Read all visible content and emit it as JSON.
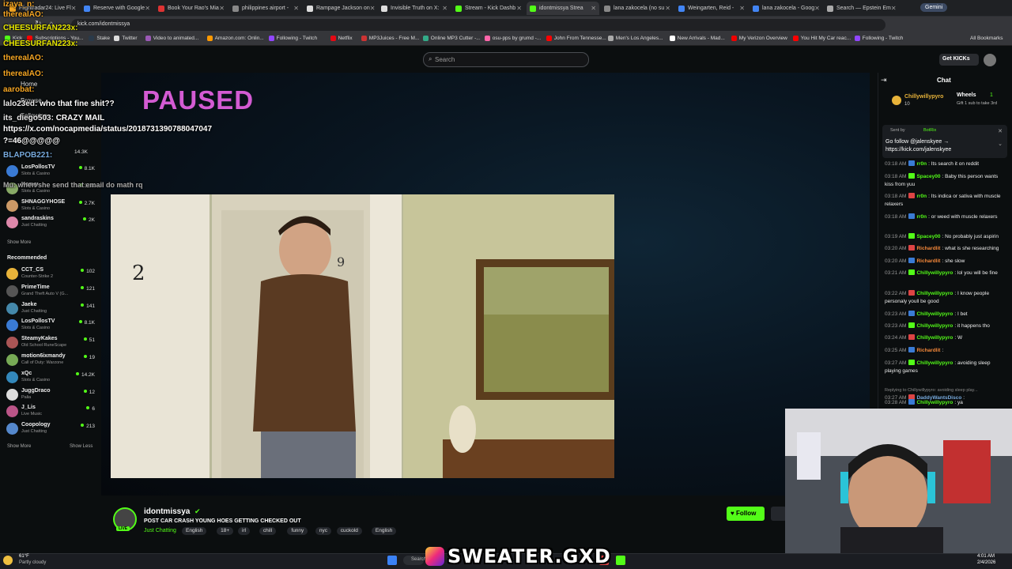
{
  "browser": {
    "tabs": [
      {
        "label": "Flightradar24: Live Fl",
        "color": "#f5a623"
      },
      {
        "label": "Reserve with Google",
        "color": "#4285f4"
      },
      {
        "label": "Book Your Rao's Mia",
        "color": "#d33"
      },
      {
        "label": "philippines airport -",
        "color": "#888"
      },
      {
        "label": "Rampage Jackson on",
        "color": "#ddd"
      },
      {
        "label": "Invisible Truth on X:",
        "color": "#ddd"
      },
      {
        "label": "Stream - Kick Dashb",
        "color": "#53fc18"
      },
      {
        "label": "idontmissya Strea",
        "color": "#53fc18",
        "active": true
      },
      {
        "label": "lana zakocela (no su",
        "color": "#888"
      },
      {
        "label": "Weingarten, Reid -",
        "color": "#4285f4"
      },
      {
        "label": "lana zakocela - Goog",
        "color": "#4285f4"
      },
      {
        "label": "Search — Epstein Em",
        "color": "#aaa"
      }
    ],
    "url": "kick.com/idontmissya",
    "gemini": "Gemini",
    "bookmarks": [
      {
        "label": "Kick",
        "color": "#53fc18"
      },
      {
        "label": "Subscriptions - You...",
        "color": "#f00"
      },
      {
        "label": "Stake",
        "color": "#2a3a4a"
      },
      {
        "label": "Twitter",
        "color": "#ddd"
      },
      {
        "label": "Video to animated...",
        "color": "#9b59b6"
      },
      {
        "label": "Amazon.com: Onlin...",
        "color": "#f90"
      },
      {
        "label": "Following - Twitch",
        "color": "#9146ff"
      },
      {
        "label": "Netflix",
        "color": "#e50914"
      },
      {
        "label": "MP3Juices - Free M...",
        "color": "#c33"
      },
      {
        "label": "Online MP3 Cutter -...",
        "color": "#3a8"
      },
      {
        "label": "osu-pps by grumd -...",
        "color": "#f6a"
      },
      {
        "label": "John From Tennesse...",
        "color": "#f00"
      },
      {
        "label": "Men's Los Angeles...",
        "color": "#aaa"
      },
      {
        "label": "New Arrivals - Mad...",
        "color": "#fff"
      },
      {
        "label": "My Verizon Overview",
        "color": "#e00"
      },
      {
        "label": "You Hit My Car reac...",
        "color": "#f00"
      },
      {
        "label": "Following - Twitch",
        "color": "#9146ff"
      }
    ],
    "all_bookmarks": "All Bookmarks"
  },
  "kick": {
    "search_placeholder": "Search",
    "get_kicks": "Get KICKs",
    "nav": {
      "home": "Home",
      "browse": "Browse",
      "following": "Following"
    },
    "following_channels": [
      {
        "name": "LosPollosTV",
        "game": "Slots & Casino",
        "viewers": "8.1K",
        "color": "#3a7bd5"
      },
      {
        "name": "Konvy",
        "game": "Slots & Casino",
        "viewers": "3.3K",
        "color": "#8a6"
      },
      {
        "name": "SHNAGGYHOSE",
        "game": "Slots & Casino",
        "viewers": "2.7K",
        "color": "#c96"
      },
      {
        "name": "sandraskins",
        "game": "Just Chatting",
        "viewers": "2K",
        "color": "#d8a"
      }
    ],
    "hidden_top_viewers": "14.3K",
    "show_more": "Show More",
    "recommended_title": "Recommended",
    "recommended_channels": [
      {
        "name": "CCT_CS",
        "game": "Counter-Strike 2",
        "viewers": "102",
        "color": "#e8b33a"
      },
      {
        "name": "PrimeTime",
        "game": "Grand Theft Auto V (G...",
        "viewers": "121",
        "color": "#555"
      },
      {
        "name": "Jaeke",
        "game": "Just Chatting",
        "viewers": "141",
        "color": "#48a"
      },
      {
        "name": "LosPollosTV",
        "game": "Slots & Casino",
        "viewers": "8.1K",
        "color": "#3a7bd5"
      },
      {
        "name": "SteamyKakes",
        "game": "Old School RuneScape",
        "viewers": "51",
        "color": "#a55"
      },
      {
        "name": "motion6ixmandy",
        "game": "Call of Duty: Warzone",
        "viewers": "19",
        "color": "#7a5"
      },
      {
        "name": "xQc",
        "game": "Slots & Casino",
        "viewers": "14.2K",
        "color": "#38b"
      },
      {
        "name": "JuggDraco",
        "game": "Palia",
        "viewers": "12",
        "color": "#ddd"
      },
      {
        "name": "J_Lis",
        "game": "Live Music",
        "viewers": "6",
        "color": "#b58"
      },
      {
        "name": "Coopology",
        "game": "Just Chatting",
        "viewers": "213",
        "color": "#58c"
      }
    ],
    "show_less": "Show Less",
    "streamer": {
      "name": "idontmissya",
      "title": "POST CAR CRASH YOUNG HOES GETTING CHECKED OUT",
      "category": "Just Chatting",
      "tags": [
        "English",
        "18+",
        "irl",
        "chill",
        "funny",
        "nyc",
        "cuckold",
        "English"
      ],
      "follow": "Follow",
      "live": "LIVE"
    },
    "video": {
      "door_number": "2",
      "wall_number": "9"
    },
    "paused_label": "PAUSED",
    "chat": {
      "title": "Chat",
      "top_user": "Chillywillypyro",
      "top_count": "10",
      "wheels": "Wheels",
      "wheels_count": "1",
      "gift_text": "Gift 1 sub to take 3rd",
      "pinned_sent_by": "Sent by",
      "pinned_bot": "BotRix",
      "pinned_text": "Go follow @jalenskyee → https://kick.com/jalenskyee",
      "messages": [
        {
          "time": "03:18 AM",
          "user": "rr0n",
          "color": "#53fc18",
          "text": "Its search it on reddit"
        },
        {
          "time": "03:18 AM",
          "user": "Spacey00",
          "color": "#53fc18",
          "text": "Baby this person wants kiss from yuu"
        },
        {
          "time": "03:18 AM",
          "user": "rr0n",
          "color": "#53fc18",
          "text": "Its indica or sativa with muscle relaxers"
        },
        {
          "time": "03:18 AM",
          "user": "rr0n",
          "color": "#53fc18",
          "text": "or weed with muscle relaxers"
        },
        {
          "time": "03:19 AM",
          "user": "Spacey00",
          "color": "#53fc18",
          "text": "No probably just aspirin"
        },
        {
          "time": "03:20 AM",
          "user": "Richardlit",
          "color": "#f5883a",
          "text": "what is she researching"
        },
        {
          "time": "03:20 AM",
          "user": "Richardlit",
          "color": "#f5883a",
          "text": "she slow"
        },
        {
          "time": "03:21 AM",
          "user": "Chillywillypyro",
          "color": "#53fc18",
          "text": "lol you will be fine"
        },
        {
          "time": "03:22 AM",
          "user": "Chillywillypyro",
          "color": "#53fc18",
          "text": "I know people personaly youll be good"
        },
        {
          "time": "03:23 AM",
          "user": "Chillywillypyro",
          "color": "#53fc18",
          "text": "I bet"
        },
        {
          "time": "03:23 AM",
          "user": "Chillywillypyro",
          "color": "#53fc18",
          "text": "it happens tho"
        },
        {
          "time": "03:24 AM",
          "user": "Chillywillypyro",
          "color": "#53fc18",
          "text": "W"
        },
        {
          "time": "03:25 AM",
          "user": "Richardlit",
          "color": "#f5883a",
          "text": ""
        },
        {
          "time": "03:27 AM",
          "user": "Chillywillypyro",
          "color": "#53fc18",
          "text": "avoiding sleep playing games"
        },
        {
          "time": "03:27 AM",
          "user": "DaddyWantsDisco",
          "color": "#7ad",
          "text": "",
          "reply": "Replying to Chillywillypyro: avoiding sleep play..."
        },
        {
          "time": "03:28 AM",
          "user": "Chillywillypyro",
          "color": "#53fc18",
          "text": "ya"
        }
      ]
    }
  },
  "overlay": {
    "lines": [
      {
        "user": "izaya_n",
        "text": "",
        "color": "#f5a623"
      },
      {
        "user": "therealAO",
        "text": "",
        "color": "#f5a623"
      },
      {
        "user": "CHEESURFAN223x",
        "text": "",
        "color": "#e8e800"
      },
      {
        "user": "CHEESURFAN223x",
        "text": "",
        "color": "#e8e800"
      },
      {
        "user": "therealAO",
        "text": "",
        "color": "#f5a623"
      },
      {
        "user": "therealAO",
        "text": "",
        "color": "#f5a623"
      },
      {
        "user": "aarobat",
        "text": "",
        "color": "#f5a623"
      },
      {
        "user": "lalo23ed",
        "text": "who that fine shit??",
        "color": "#e8e8e8"
      },
      {
        "user": "its_diego503",
        "text": "CRAZY MAIL",
        "color": "#e8e8e8"
      },
      {
        "user": "",
        "text": "https://x.com/nocapmedia/status/2018731390788047047",
        "color": "#fff"
      },
      {
        "user": "",
        "text": "?=46@@@@@",
        "color": "#fff"
      },
      {
        "user": "BLAPOB221",
        "text": "",
        "color": "#7ad"
      },
      {
        "user": "Mu",
        "text": "when she send that email do math rq",
        "color": "#aaa"
      }
    ]
  },
  "taskbar": {
    "weather_temp": "61°F",
    "weather_desc": "Partly cloudy",
    "search": "Search",
    "time": "4:01 AM",
    "date": "2/4/2026"
  },
  "watermark": "SWEATER.GXD"
}
